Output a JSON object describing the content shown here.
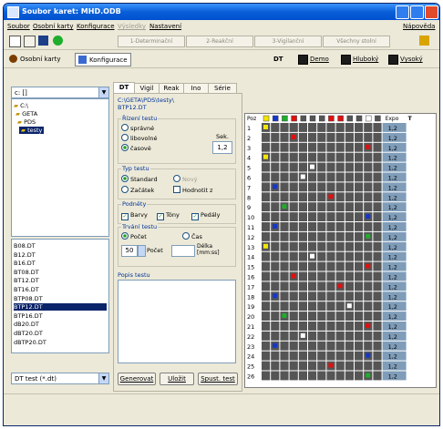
{
  "window": {
    "title": "Soubor karet: MHD.ODB"
  },
  "menu": [
    "Soubor",
    "Osobní karty",
    "Konfigurace",
    "Výsledky",
    "Nastavení",
    "Nápověda"
  ],
  "toolbar": {
    "segments": [
      "1-Determinační",
      "2-Reakční",
      "3-Vigilanční",
      "Všechny stolní"
    ]
  },
  "cardbar": {
    "osobni_karty": "Osobní karty",
    "konfigurace": "Konfigurace",
    "dt": "DT",
    "demo": "Demo",
    "hluboky": "Hluboký",
    "vysoky": "Vysoký"
  },
  "left": {
    "drive": "c: []",
    "tree": [
      "C:\\",
      "GETA",
      "PDS",
      "testy"
    ],
    "files": [
      "B08.DT",
      "B12.DT",
      "B16.DT",
      "BT08.DT",
      "BT12.DT",
      "BT16.DT",
      "BTP08.DT",
      "BTP12.DT",
      "BTP16.DT",
      "dB20.DT",
      "dBT20.DT",
      "dBTP20.DT"
    ],
    "selected_file": "BTP12.DT",
    "filter": "DT test (*.dt)"
  },
  "tabs": [
    "DT",
    "Vigil",
    "Reak",
    "Ino",
    "Série"
  ],
  "panel": {
    "path": "C:\\GETA\\PDS\\testy\\",
    "file": "BTP12.DT",
    "rizeni_title": "Řízení testu",
    "rizeni": [
      "správné",
      "libovolné",
      "časové"
    ],
    "sek_label": "Sek.",
    "sek_value": "1,2",
    "typ_title": "Typ testu",
    "typ_standard": "Standard",
    "typ_novy": "Nový",
    "typ_zacatek": "Začátek",
    "typ_hodnoceni": "Hodnotit z",
    "podnety_title": "Podněty",
    "podnety": [
      "Barvy",
      "Tóny",
      "Pedály"
    ],
    "trvani_title": "Trvání testu",
    "pocet": "Počet",
    "cas": "Čas",
    "pocet_value": "50",
    "pocet_label": "Počet",
    "delka_label": "Délka [mm:ss]",
    "popis_title": "Popis testu",
    "btn_generovat": "Generovat",
    "btn_ulozit": "Uložit",
    "btn_spust": "Spust. test"
  },
  "grid": {
    "header_pos": "Poz",
    "header_expo": "Expo",
    "header_t": "T",
    "exposure": "1,2"
  },
  "colors": {
    "yellow": "#f2e600",
    "blue": "#1636c8",
    "green": "#1fae2c",
    "red": "#e01010",
    "white": "#ffffff",
    "cell": "#555555"
  }
}
